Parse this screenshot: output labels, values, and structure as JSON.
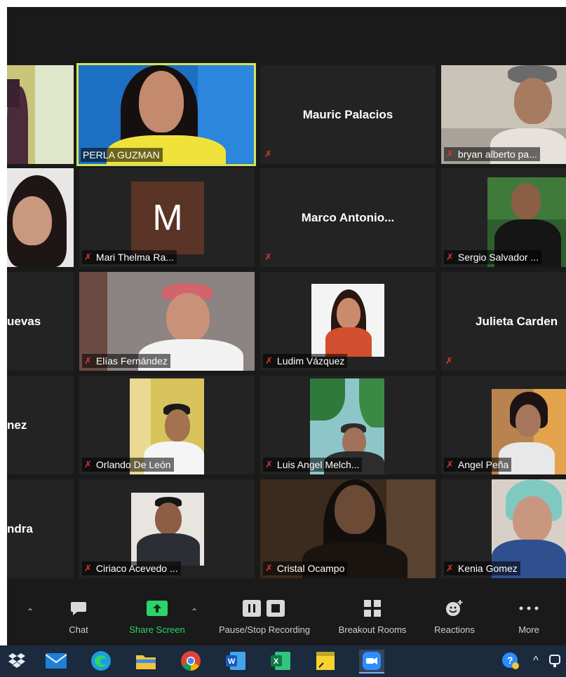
{
  "participants": [
    {
      "name": "",
      "muted": false
    },
    {
      "name": "PERLA GUZMAN",
      "muted": false,
      "active_speaker": true
    },
    {
      "name": "Mauric Palacios",
      "muted": true
    },
    {
      "name": "bryan alberto pa...",
      "muted": true
    },
    {
      "name": "",
      "muted": false
    },
    {
      "name": "Mari Thelma Ra...",
      "muted": true,
      "avatar_letter": "M"
    },
    {
      "name": "Marco  Antonio...",
      "muted": true
    },
    {
      "name": "Sergio Salvador ...",
      "muted": true
    },
    {
      "name": "uevas",
      "muted": false
    },
    {
      "name": "Elías Fernández",
      "muted": true
    },
    {
      "name": "Ludim Vázquez",
      "muted": true
    },
    {
      "name": "Julieta Carden",
      "muted": true
    },
    {
      "name": "nez",
      "muted": false
    },
    {
      "name": "Orlando De León",
      "muted": true
    },
    {
      "name": "Luis Angel Melch...",
      "muted": true
    },
    {
      "name": "Angel Peña",
      "muted": true
    },
    {
      "name": "ndra",
      "muted": false
    },
    {
      "name": "Ciriaco Acevedo ...",
      "muted": true
    },
    {
      "name": "Cristal Ocampo",
      "muted": true
    },
    {
      "name": "Kenia Gomez",
      "muted": true
    }
  ],
  "toolbar": {
    "chat": "Chat",
    "share_screen": "Share Screen",
    "pause_stop_recording": "Pause/Stop Recording",
    "breakout_rooms": "Breakout Rooms",
    "reactions": "Reactions",
    "more": "More"
  },
  "colors": {
    "active_speaker_border": "#d5e25a",
    "muted_icon": "#e0342f",
    "share_screen": "#2bd46b",
    "taskbar": "#1b2a3d"
  },
  "taskbar_icons": [
    "dropbox-icon",
    "mail-icon",
    "edge-icon",
    "file-explorer-icon",
    "chrome-icon",
    "word-icon",
    "excel-icon",
    "sticky-notes-icon",
    "zoom-icon",
    "help-icon",
    "chevron-up-icon"
  ]
}
